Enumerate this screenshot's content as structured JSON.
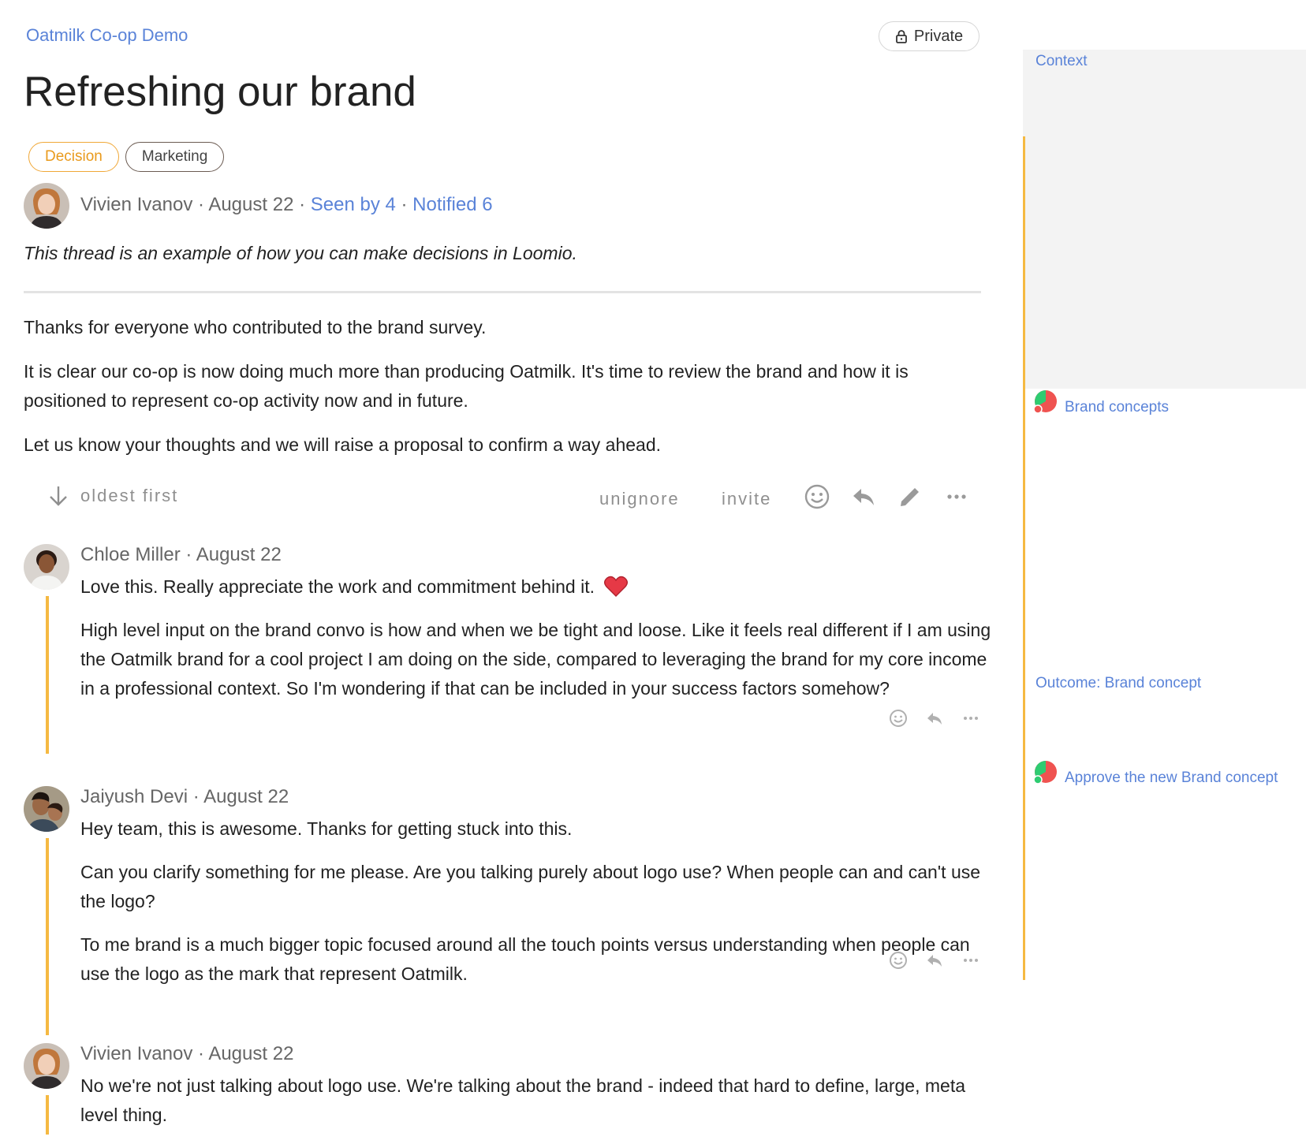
{
  "header": {
    "group_name": "Oatmilk Co-op Demo",
    "privacy_label": "Private",
    "title": "Refreshing our brand",
    "tags": [
      "Decision",
      "Marketing"
    ]
  },
  "thread": {
    "author": "Vivien Ivanov",
    "sep1": " · ",
    "date": "August 22",
    "sep2": " · ",
    "seen": "Seen by 4",
    "sep3": " · ",
    "notified": "Notified 6",
    "intro": "This thread is an example of how you can make decisions in Loomio.",
    "body": [
      "Thanks for everyone who contributed to the brand survey.",
      "It is clear our co-op is now doing much more than producing Oatmilk. It's time to review the brand and how it is positioned to represent co-op activity now and in future.",
      "Let us know your thoughts and we will raise a proposal to confirm a way ahead."
    ]
  },
  "actions": {
    "sort_label": "oldest first",
    "unignore": "unignore",
    "invite": "invite",
    "icons": [
      "sort-arrow-icon",
      "emoji-icon",
      "reply-icon",
      "edit-icon",
      "more-icon"
    ]
  },
  "comments": [
    {
      "author": "Chloe Miller",
      "date": "August 22",
      "paragraphs": [
        "Love this. Really appreciate the work and commitment behind it.",
        "High level input on the brand convo is how and when we be tight and loose. Like it feels real different if I am using the Oatmilk brand for a cool project I am doing on the side, compared to leveraging the brand for my core income in a professional context. So I'm wondering if that can be included in your success factors somehow?"
      ],
      "emoji": "heart"
    },
    {
      "author": "Jaiyush Devi",
      "date": "August 22",
      "paragraphs": [
        "Hey team, this is awesome. Thanks for getting stuck into this.",
        "Can you clarify something for me please. Are you talking purely about logo use? When people can and can't use the logo?",
        "To me brand is a much bigger topic focused around all the touch points versus understanding when people can use the logo as the mark that represent Oatmilk."
      ]
    },
    {
      "author": "Vivien Ivanov",
      "date": "August 22",
      "paragraphs": [
        "No we're not just talking about logo use. We're talking about the brand - indeed that hard to define, large, meta level thing."
      ]
    }
  ],
  "sidebar": {
    "context": "Context",
    "poll1": "Brand concepts",
    "outcome": "Outcome: Brand concept",
    "poll2": "Approve the new Brand concept"
  },
  "colors": {
    "accent": "#5a83d8",
    "timeline": "#f5b942",
    "decision_tag": "#f0a838",
    "pie_red": "#ef5350",
    "pie_green": "#2ecc71"
  }
}
